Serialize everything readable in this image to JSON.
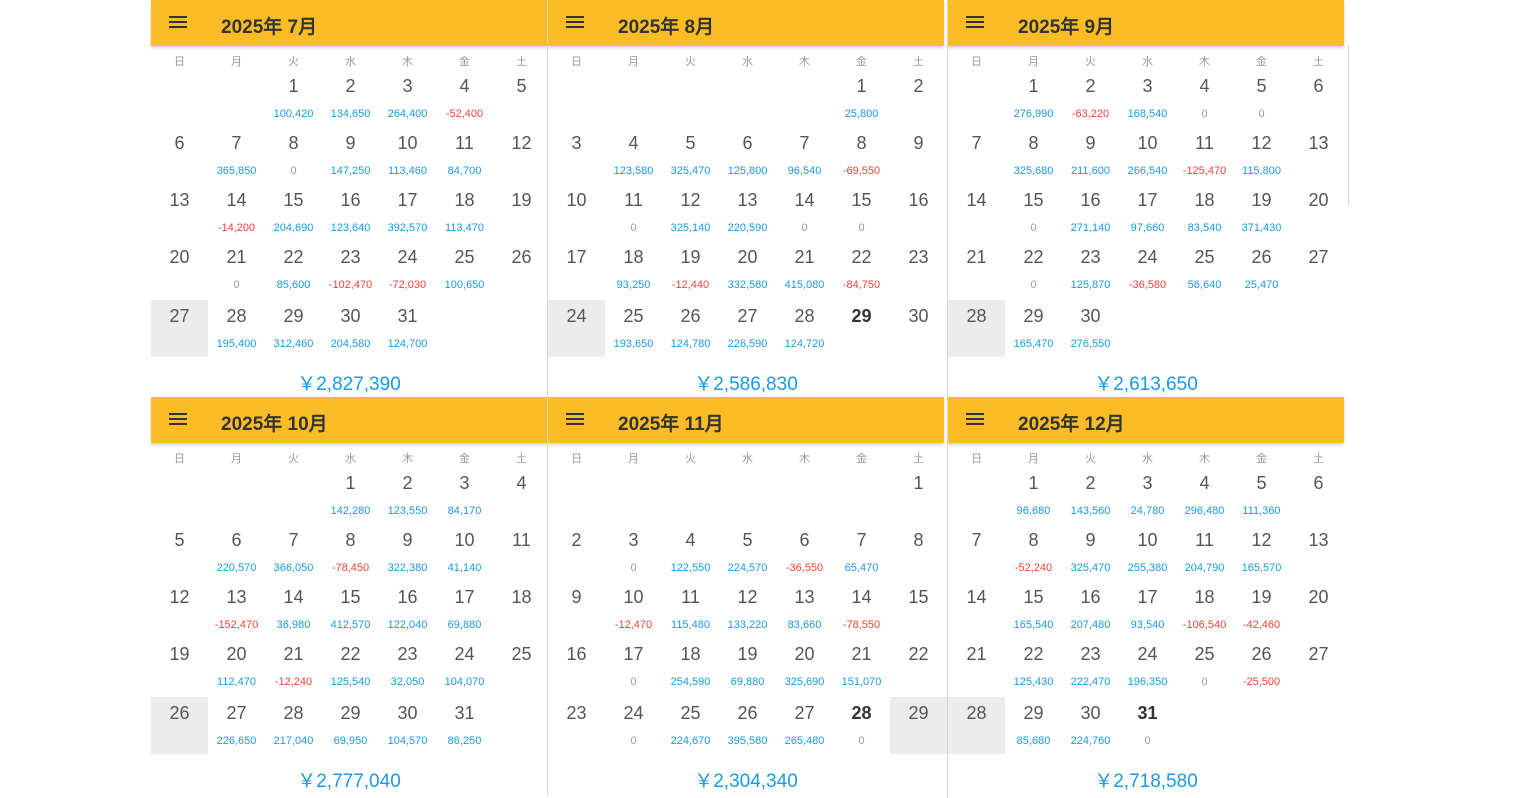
{
  "weekday_labels": [
    "日",
    "月",
    "火",
    "水",
    "木",
    "金",
    "土"
  ],
  "menu_icon": "menu-icon",
  "colors": {
    "header": "#fbbd26",
    "positive": "#1a9ae3",
    "negative": "#f44336",
    "zero": "#9a9a9a",
    "today_bg": "#ececec"
  },
  "calendars": [
    {
      "title": "2025年 7月",
      "first_weekday": 2,
      "total": "￥2,827,390",
      "today": 27,
      "days": [
        [
          "1",
          "100,420"
        ],
        [
          "2",
          "134,650"
        ],
        [
          "3",
          "264,400"
        ],
        [
          "4",
          "-52,400"
        ],
        [
          "5",
          ""
        ],
        [
          "6",
          ""
        ],
        [
          "7",
          "365,850"
        ],
        [
          "8",
          "0"
        ],
        [
          "9",
          "147,250"
        ],
        [
          "10",
          "113,460"
        ],
        [
          "11",
          "84,700"
        ],
        [
          "12",
          ""
        ],
        [
          "13",
          ""
        ],
        [
          "14",
          "-14,200"
        ],
        [
          "15",
          "204,690"
        ],
        [
          "16",
          "123,640"
        ],
        [
          "17",
          "392,570"
        ],
        [
          "18",
          "113,470"
        ],
        [
          "19",
          ""
        ],
        [
          "20",
          ""
        ],
        [
          "21",
          "0"
        ],
        [
          "22",
          "85,600"
        ],
        [
          "23",
          "-102,470"
        ],
        [
          "24",
          "-72,030"
        ],
        [
          "25",
          "100,650"
        ],
        [
          "26",
          ""
        ],
        [
          "27",
          ""
        ],
        [
          "28",
          "195,400"
        ],
        [
          "29",
          "312,460"
        ],
        [
          "30",
          "204,580"
        ],
        [
          "31",
          "124,700"
        ]
      ]
    },
    {
      "title": "2025年 8月",
      "first_weekday": 5,
      "total": "￥2,586,830",
      "today": 24,
      "selected": 29,
      "days": [
        [
          "1",
          "25,800"
        ],
        [
          "2",
          ""
        ],
        [
          "3",
          ""
        ],
        [
          "4",
          "123,580"
        ],
        [
          "5",
          "325,470"
        ],
        [
          "6",
          "125,800"
        ],
        [
          "7",
          "96,540"
        ],
        [
          "8",
          "-69,550"
        ],
        [
          "9",
          ""
        ],
        [
          "10",
          ""
        ],
        [
          "11",
          "0"
        ],
        [
          "12",
          "325,140"
        ],
        [
          "13",
          "220,590"
        ],
        [
          "14",
          "0"
        ],
        [
          "15",
          "0"
        ],
        [
          "16",
          ""
        ],
        [
          "17",
          ""
        ],
        [
          "18",
          "93,250"
        ],
        [
          "19",
          "-12,440"
        ],
        [
          "20",
          "332,580"
        ],
        [
          "21",
          "415,080"
        ],
        [
          "22",
          "-84,750"
        ],
        [
          "23",
          ""
        ],
        [
          "24",
          ""
        ],
        [
          "25",
          "193,650"
        ],
        [
          "26",
          "124,780"
        ],
        [
          "27",
          "226,590"
        ],
        [
          "28",
          "124,720"
        ],
        [
          "29",
          ""
        ],
        [
          "30",
          ""
        ]
      ]
    },
    {
      "title": "2025年 9月",
      "first_weekday": 1,
      "total": "￥2,613,650",
      "today": 28,
      "days": [
        [
          "1",
          "276,990"
        ],
        [
          "2",
          "-63,220"
        ],
        [
          "3",
          "168,540"
        ],
        [
          "4",
          "0"
        ],
        [
          "5",
          "0"
        ],
        [
          "6",
          ""
        ],
        [
          "7",
          ""
        ],
        [
          "8",
          "325,680"
        ],
        [
          "9",
          "211,600"
        ],
        [
          "10",
          "266,540"
        ],
        [
          "11",
          "-125,470"
        ],
        [
          "12",
          "115,800"
        ],
        [
          "13",
          ""
        ],
        [
          "14",
          ""
        ],
        [
          "15",
          "0"
        ],
        [
          "16",
          "271,140"
        ],
        [
          "17",
          "97,660"
        ],
        [
          "18",
          "83,540"
        ],
        [
          "19",
          "371,430"
        ],
        [
          "20",
          ""
        ],
        [
          "21",
          ""
        ],
        [
          "22",
          "0"
        ],
        [
          "23",
          "125,870"
        ],
        [
          "24",
          "-36,580"
        ],
        [
          "25",
          "56,640"
        ],
        [
          "26",
          "25,470"
        ],
        [
          "27",
          ""
        ],
        [
          "28",
          ""
        ],
        [
          "29",
          "165,470"
        ],
        [
          "30",
          "276,550"
        ]
      ]
    },
    {
      "title": "2025年 10月",
      "first_weekday": 3,
      "total": "￥2,777,040",
      "today": 26,
      "days": [
        [
          "1",
          "142,280"
        ],
        [
          "2",
          "123,550"
        ],
        [
          "3",
          "84,170"
        ],
        [
          "4",
          ""
        ],
        [
          "5",
          ""
        ],
        [
          "6",
          "220,570"
        ],
        [
          "7",
          "366,050"
        ],
        [
          "8",
          "-78,450"
        ],
        [
          "9",
          "322,380"
        ],
        [
          "10",
          "41,140"
        ],
        [
          "11",
          ""
        ],
        [
          "12",
          ""
        ],
        [
          "13",
          "-152,470"
        ],
        [
          "14",
          "36,980"
        ],
        [
          "15",
          "412,570"
        ],
        [
          "16",
          "122,040"
        ],
        [
          "17",
          "69,880"
        ],
        [
          "18",
          ""
        ],
        [
          "19",
          ""
        ],
        [
          "20",
          "112,470"
        ],
        [
          "21",
          "-12,240"
        ],
        [
          "22",
          "125,540"
        ],
        [
          "23",
          "32,050"
        ],
        [
          "24",
          "104,070"
        ],
        [
          "25",
          ""
        ],
        [
          "26",
          ""
        ],
        [
          "27",
          "226,650"
        ],
        [
          "28",
          "217,040"
        ],
        [
          "29",
          "69,950"
        ],
        [
          "30",
          "104,570"
        ],
        [
          "31",
          "86,250"
        ]
      ]
    },
    {
      "title": "2025年 11月",
      "first_weekday": 6,
      "total": "￥2,304,340",
      "today": 29,
      "selected": 28,
      "days": [
        [
          "1",
          ""
        ],
        [
          "2",
          ""
        ],
        [
          "3",
          "0"
        ],
        [
          "4",
          "122,550"
        ],
        [
          "5",
          "224,570"
        ],
        [
          "6",
          "-36,550"
        ],
        [
          "7",
          "65,470"
        ],
        [
          "8",
          ""
        ],
        [
          "9",
          ""
        ],
        [
          "10",
          "-12,470"
        ],
        [
          "11",
          "115,480"
        ],
        [
          "12",
          "133,220"
        ],
        [
          "13",
          "83,660"
        ],
        [
          "14",
          "-78,550"
        ],
        [
          "15",
          ""
        ],
        [
          "16",
          ""
        ],
        [
          "17",
          "0"
        ],
        [
          "18",
          "254,590"
        ],
        [
          "19",
          "69,880"
        ],
        [
          "20",
          "325,690"
        ],
        [
          "21",
          "151,070"
        ],
        [
          "22",
          ""
        ],
        [
          "23",
          ""
        ],
        [
          "24",
          "0"
        ],
        [
          "25",
          "224,670"
        ],
        [
          "26",
          "395,580"
        ],
        [
          "27",
          "265,480"
        ],
        [
          "28",
          "0"
        ],
        [
          "29",
          ""
        ]
      ]
    },
    {
      "title": "2025年 12月",
      "first_weekday": 1,
      "total": "￥2,718,580",
      "today": 28,
      "selected": 31,
      "days": [
        [
          "1",
          "96,680"
        ],
        [
          "2",
          "143,560"
        ],
        [
          "3",
          "24,780"
        ],
        [
          "4",
          "296,480"
        ],
        [
          "5",
          "111,360"
        ],
        [
          "6",
          ""
        ],
        [
          "7",
          ""
        ],
        [
          "8",
          "-52,240"
        ],
        [
          "9",
          "325,470"
        ],
        [
          "10",
          "255,380"
        ],
        [
          "11",
          "204,790"
        ],
        [
          "12",
          "165,570"
        ],
        [
          "13",
          ""
        ],
        [
          "14",
          ""
        ],
        [
          "15",
          "165,540"
        ],
        [
          "16",
          "207,480"
        ],
        [
          "17",
          "93,540"
        ],
        [
          "18",
          "-106,540"
        ],
        [
          "19",
          "-42,460"
        ],
        [
          "20",
          ""
        ],
        [
          "21",
          ""
        ],
        [
          "22",
          "125,430"
        ],
        [
          "23",
          "222,470"
        ],
        [
          "24",
          "196,350"
        ],
        [
          "25",
          "0"
        ],
        [
          "26",
          "-25,500"
        ],
        [
          "27",
          ""
        ],
        [
          "28",
          ""
        ],
        [
          "29",
          "85,680"
        ],
        [
          "30",
          "224,760"
        ],
        [
          "31",
          "0"
        ]
      ]
    }
  ]
}
